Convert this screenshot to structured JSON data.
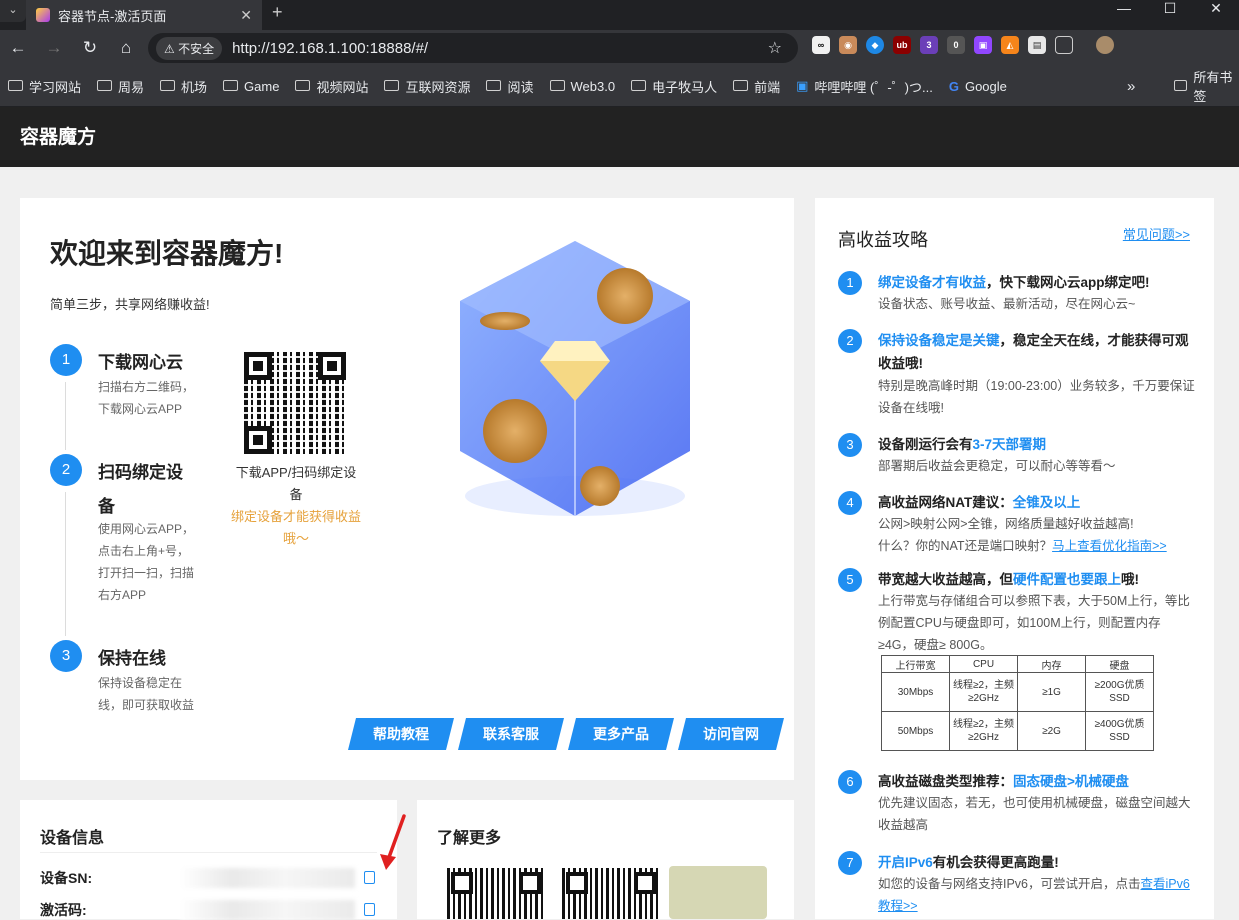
{
  "browser": {
    "tab_title": "容器节点-激活页面",
    "tab_close": "✕",
    "new_tab": "+",
    "window_minimize": "—",
    "window_maximize": "☐",
    "window_close": "✕",
    "insecure_label": "⚠ 不安全",
    "url": "http://192.168.1.100:18888/#/",
    "extension_badges": [
      "3",
      "0"
    ],
    "bookmarks": [
      "学习网站",
      "周易",
      "机场",
      "Game",
      "视频网站",
      "互联网资源",
      "阅读",
      "Web3.0",
      "电子牧马人",
      "前端"
    ],
    "bookmark_bilibili": "哔哩哔哩 (゜-゜)つ...",
    "bookmark_google": "Google",
    "bookmark_more": "»",
    "bookmark_all": "所有书签"
  },
  "app": {
    "title": "容器魔方"
  },
  "welcome": {
    "heading": "欢迎来到容器魔方!",
    "subtitle": "简单三步，共享网络赚收益!",
    "steps": [
      {
        "num": "1",
        "title": "下载网心云",
        "desc": "扫描右方二维码，下载网心云APP"
      },
      {
        "num": "2",
        "title": "扫码绑定设备",
        "desc": "使用网心云APP，点击右上角+号，打开扫一扫，扫描右方APP"
      },
      {
        "num": "3",
        "title": "保持在线",
        "desc": "保持设备稳定在线，即可获取收益"
      }
    ],
    "qr_caption": "下载APP/扫码绑定设备",
    "qr_note": "绑定设备才能获得收益哦～",
    "buttons": [
      "帮助教程",
      "联系客服",
      "更多产品",
      "访问官网"
    ]
  },
  "strategy": {
    "title": "高收益攻略",
    "faq_link": "常见问题>>",
    "tips": [
      {
        "num": "1",
        "hl": "绑定设备才有收益",
        "rest": "，快下载网心云app绑定吧!",
        "desc": "设备状态、账号收益、最新活动，尽在网心云~"
      },
      {
        "num": "2",
        "hl": "保持设备稳定是关键",
        "rest": "，稳定全天在线，才能获得可观收益哦!",
        "desc": "特别是晚高峰时期（19:00-23:00）业务较多，千万要保证设备在线哦!"
      },
      {
        "num": "3",
        "pre": "设备刚运行会有",
        "hl": "3-7天部署期",
        "desc": "部署期后收益会更稳定，可以耐心等等看～"
      },
      {
        "num": "4",
        "pre": "高收益网络NAT建议：",
        "hl": "全锥及以上",
        "desc": "公网>映射公网>全锥，网络质量越好收益越高!",
        "desc2": "什么？你的NAT还是端口映射？",
        "link": "马上查看优化指南>>"
      },
      {
        "num": "5",
        "pre": "带宽越大收益越高，但",
        "hl": "硬件配置也要跟上",
        "rest": "哦!",
        "desc": "上行带宽与存储组合可以参照下表，大于50M上行，等比例配置CPU与硬盘即可，如100M上行，则配置内存≥4G，硬盘≥ 800G。"
      },
      {
        "num": "6",
        "pre": "高收益磁盘类型推荐：",
        "hl": "固态硬盘>机械硬盘",
        "desc": "优先建议固态，若无，也可使用机械硬盘，磁盘空间越大收益越高"
      },
      {
        "num": "7",
        "hl": "开启IPv6",
        "rest": "有机会获得更高跑量!",
        "desc": "如您的设备与网络支持IPv6，可尝试开启，点击",
        "link": "查看iPv6教程>>"
      }
    ],
    "table": {
      "headers": [
        "上行带宽",
        "CPU",
        "内存",
        "硬盘"
      ],
      "rows": [
        [
          "30Mbps",
          "线程≥2，主频≥2GHz",
          "≥1G",
          "≥200G优质SSD"
        ],
        [
          "50Mbps",
          "线程≥2，主频≥2GHz",
          "≥2G",
          "≥400G优质SSD"
        ]
      ]
    }
  },
  "device": {
    "title": "设备信息",
    "sn_label": "设备SN:",
    "code_label": "激活码:"
  },
  "more": {
    "title": "了解更多"
  },
  "colors": {
    "accent": "#1f8ef1",
    "warning": "#e6a23c",
    "header_bg": "#222222"
  }
}
